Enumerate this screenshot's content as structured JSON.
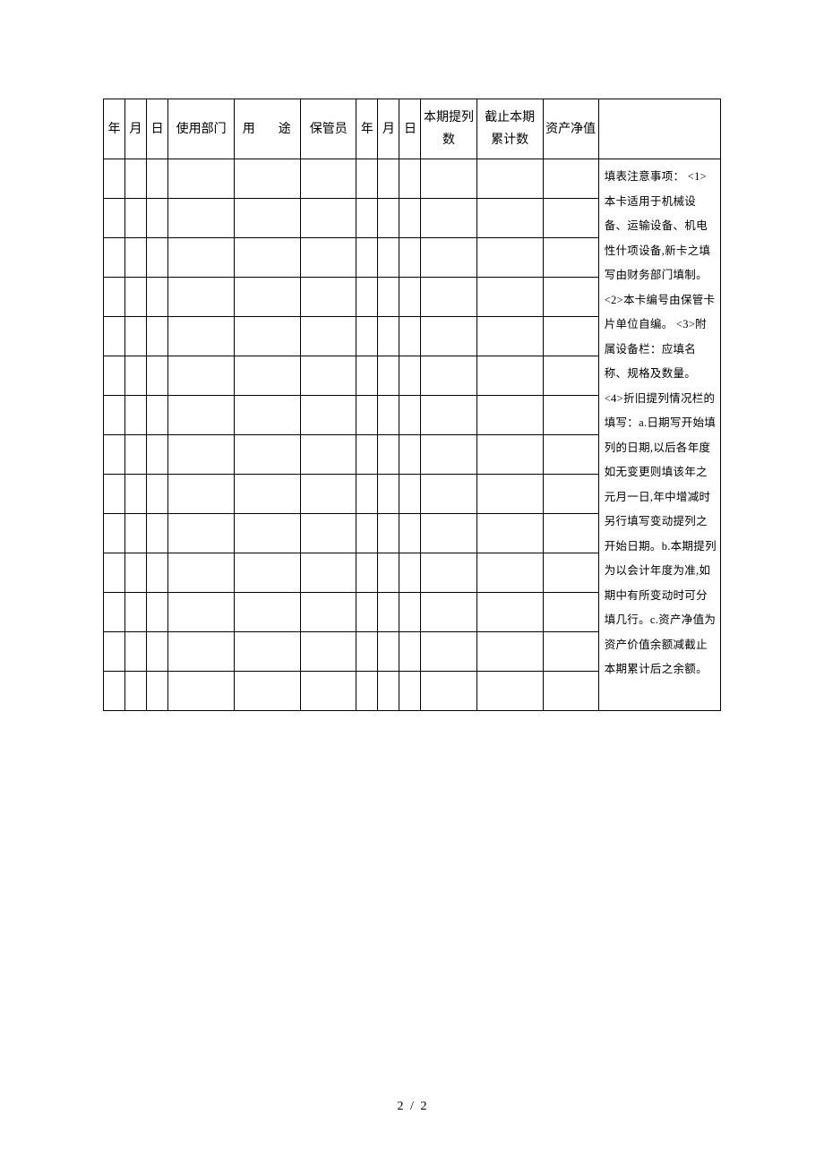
{
  "table": {
    "headers": {
      "year": "年",
      "month": "月",
      "day": "日",
      "department": "使用部门",
      "usage": "用　途",
      "keeper": "保管员",
      "year2": "年",
      "month2": "月",
      "day2": "日",
      "current_period": "本期提列数",
      "cumulative": "截止本期累计数",
      "net_value": "资产净值"
    },
    "row_count": 14,
    "notes": "填表注意事项：\n<1>本卡适用于机械设备、运输设备、机电性什项设备,新卡之填写由财务部门填制。\n<2>本卡编号由保管卡片单位自编。\n<3>附属设备栏：应填名称、规格及数量。\n<4>折旧提列情况栏的填写：a.日期写开始填列的日期,以后各年度如无变更则填该年之元月一日,年中增减时另行填写变动提列之开始日期。b.本期提列为以会计年度为准,如期中有所变动时可分填几行。c.资产净值为资产价值余额减截止本期累计后之余额。"
  },
  "footer": {
    "current_page": "2",
    "total_pages": "2",
    "separator": "/"
  }
}
